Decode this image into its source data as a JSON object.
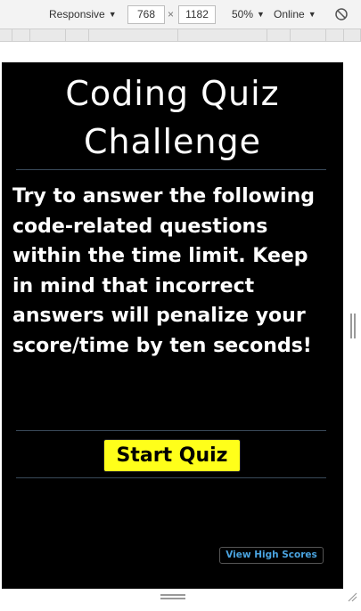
{
  "devtools": {
    "device_mode": "Responsive",
    "width": "768",
    "height": "1182",
    "zoom": "50%",
    "network": "Online",
    "icons": [
      "caret-down-icon",
      "rotate-icon",
      "resize-handle-icon"
    ]
  },
  "quiz": {
    "title": "Coding Quiz Challenge",
    "instructions": "Try to answer the following code-related questions within the time limit. Keep in mind that incorrect answers will penalize your score/time by ten seconds!",
    "start_label": "Start Quiz",
    "high_scores_label": "View High Scores"
  },
  "colors": {
    "page_background": "#000000",
    "start_button": "#ffff1a",
    "high_scores_link": "#4aa3df",
    "text": "#ffffff"
  }
}
